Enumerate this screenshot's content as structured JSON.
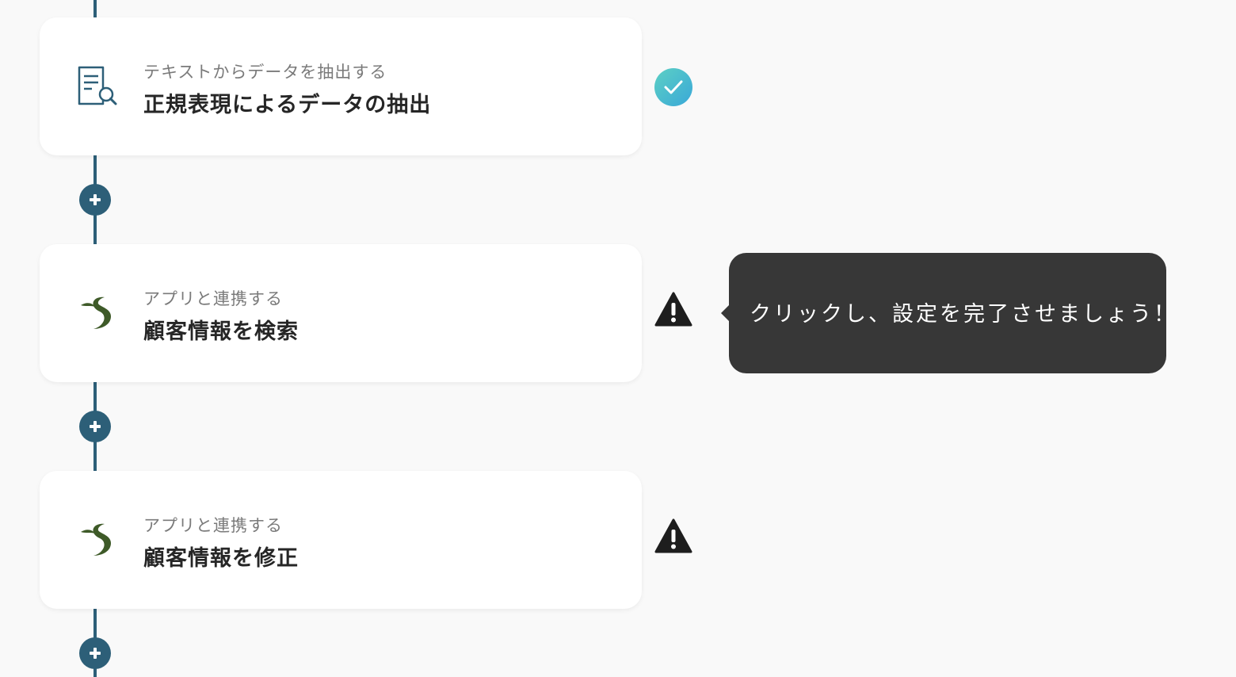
{
  "steps": [
    {
      "icon": "document-search-icon",
      "subtitle": "テキストからデータを抽出する",
      "title": "正規表現によるデータの抽出",
      "status": "complete"
    },
    {
      "icon": "app-logo-icon",
      "subtitle": "アプリと連携する",
      "title": "顧客情報を検索",
      "status": "warning"
    },
    {
      "icon": "app-logo-icon",
      "subtitle": "アプリと連携する",
      "title": "顧客情報を修正",
      "status": "warning"
    }
  ],
  "tooltip": {
    "text": "クリックし、設定を完了させましょう！"
  },
  "colors": {
    "background": "#f9f9f9",
    "connector": "#2d5f78",
    "check_gradient_start": "#5cd0c4",
    "check_gradient_end": "#3aa8d8",
    "warning": "#1e1e1e",
    "tooltip_bg": "#373737",
    "app_logo": "#3e5a28",
    "doc_icon": "#2d5f78"
  }
}
